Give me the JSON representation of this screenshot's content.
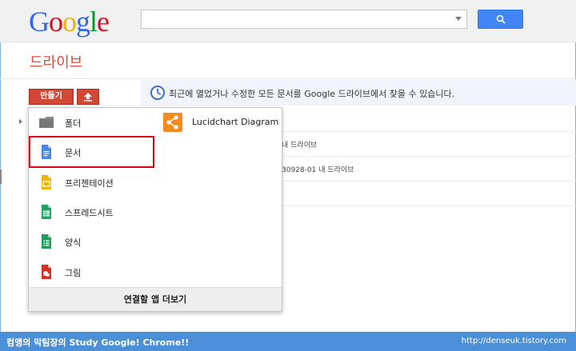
{
  "logo": {
    "letters": [
      "G",
      "o",
      "o",
      "g",
      "l",
      "e"
    ],
    "colors": [
      "#3369e8",
      "#d50f25",
      "#eeb211",
      "#3369e8",
      "#009925",
      "#d50f25"
    ]
  },
  "search": {
    "value": "",
    "placeholder": ""
  },
  "page": {
    "title": "드라이브"
  },
  "toolbar": {
    "create_label": "만들기"
  },
  "info": {
    "text": "최근에 열었거나 수정한 모든 문서를 Google 드라이브에서 찾을 수 있습니다."
  },
  "rows": [
    {
      "text": "내 드라이브"
    },
    {
      "text": "30928-01  내 드라이브"
    }
  ],
  "menu": {
    "items": [
      {
        "label": "폴더",
        "icon": "folder-icon"
      },
      {
        "label": "문서",
        "icon": "document-icon"
      },
      {
        "label": "프리젠테이션",
        "icon": "presentation-icon"
      },
      {
        "label": "스프레드시트",
        "icon": "spreadsheet-icon"
      },
      {
        "label": "양식",
        "icon": "form-icon"
      },
      {
        "label": "그림",
        "icon": "drawing-icon"
      }
    ],
    "apps": [
      {
        "label": "Lucidchart Diagram",
        "icon": "lucidchart-icon"
      }
    ],
    "footer_label": "연결할 앱 더보기"
  },
  "footer": {
    "left_text": "컴맹의 막팀장의 Study Google! Chrome!!",
    "right_text": "http://denseuk.tistory.com"
  },
  "colors": {
    "accent_red": "#d14836",
    "title_red": "#dd4b39",
    "search_blue": "#4285f4",
    "highlight_red": "#e3001b",
    "strip_blue": "#4a90d9"
  }
}
